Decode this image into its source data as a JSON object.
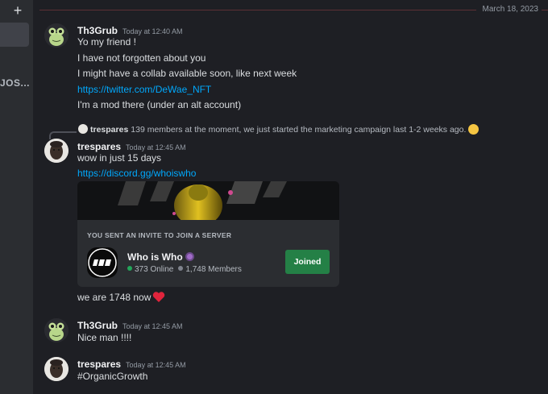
{
  "sidebar": {
    "add_icon": "plus-icon",
    "cut_label": "JOS..."
  },
  "chat": {
    "date_divider": "March 18, 2023",
    "messages": [
      {
        "author": "Th3Grub",
        "time": "Today at 12:40 AM",
        "avatar": "frog-avatar",
        "lines": [
          "Yo my friend !",
          "I have not forgotten about you",
          "I might have a collab available soon, like next week",
          "https://twitter.com/DeWae_NFT",
          "I'm a mod there (under an alt account)"
        ]
      },
      {
        "reply": {
          "author": "trespares",
          "text": "139 members at the moment, we just started the marketing campaign last 1-2 weeks ago.",
          "emoji": "slightly-smiling-face-icon"
        },
        "author": "trespares",
        "time": "Today at 12:45 AM",
        "avatar": "face-avatar",
        "lines": [
          "wow in just 15 days",
          "https://discord.gg/whoiswho"
        ],
        "invite": {
          "header": "YOU SENT AN INVITE TO JOIN A SERVER",
          "server_name": "Who is Who",
          "online": "373 Online",
          "members": "1,748 Members",
          "button": "Joined",
          "button_color": "#248046"
        },
        "after_line": "we are 1748 now",
        "after_emoji": "red-heart-icon"
      },
      {
        "author": "Th3Grub",
        "time": "Today at 12:45 AM",
        "avatar": "frog-avatar",
        "lines": [
          "Nice man !!!!"
        ]
      },
      {
        "author": "trespares",
        "time": "Today at 12:45 AM",
        "avatar": "face-avatar",
        "lines": [
          "#OrganicGrowth"
        ]
      }
    ]
  },
  "colors": {
    "background": "#1e1f24",
    "link": "#00a8fc",
    "divider": "#5c3035"
  }
}
